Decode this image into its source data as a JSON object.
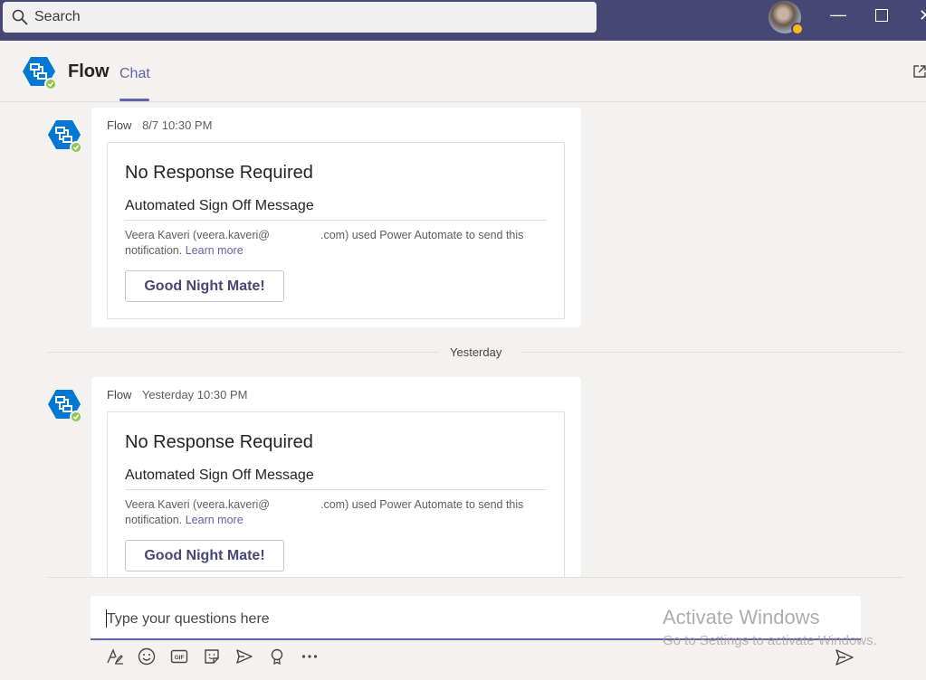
{
  "search": {
    "label": "Search"
  },
  "header": {
    "title": "Flow",
    "tab": "Chat"
  },
  "messages": [
    {
      "sender": "Flow",
      "time": "8/7 10:30 PM",
      "card": {
        "title": "No Response Required",
        "subtitle": "Automated Sign Off Message",
        "note_prefix": "Veera Kaveri (veera.kaveri@",
        "note_suffix": ".com) used Power Automate to send this notification.",
        "link": "Learn more",
        "button": "Good Night Mate!"
      }
    },
    {
      "sender": "Flow",
      "time": "Yesterday 10:30 PM",
      "card": {
        "title": "No Response Required",
        "subtitle": "Automated Sign Off Message",
        "note_prefix": "Veera Kaveri (veera.kaveri@",
        "note_suffix": ".com) used Power Automate to send this notification.",
        "link": "Learn more",
        "button": "Good Night Mate!"
      }
    }
  ],
  "day_divider": "Yesterday",
  "compose": {
    "placeholder": "Type your questions here"
  },
  "toolbar": {
    "icons": [
      "format-icon",
      "emoji-icon",
      "gif-icon",
      "sticker-icon",
      "schedule-send-icon",
      "praise-icon",
      "more-options-icon"
    ],
    "send_icon": "send-icon"
  },
  "watermark": {
    "title": "Activate Windows",
    "subtitle": "Go to Settings to activate Windows."
  },
  "colors": {
    "titlebar": "#464775",
    "accent": "#6264a7",
    "background": "#f3f2f1",
    "bot": "#0078d4",
    "online": "#92c353"
  }
}
